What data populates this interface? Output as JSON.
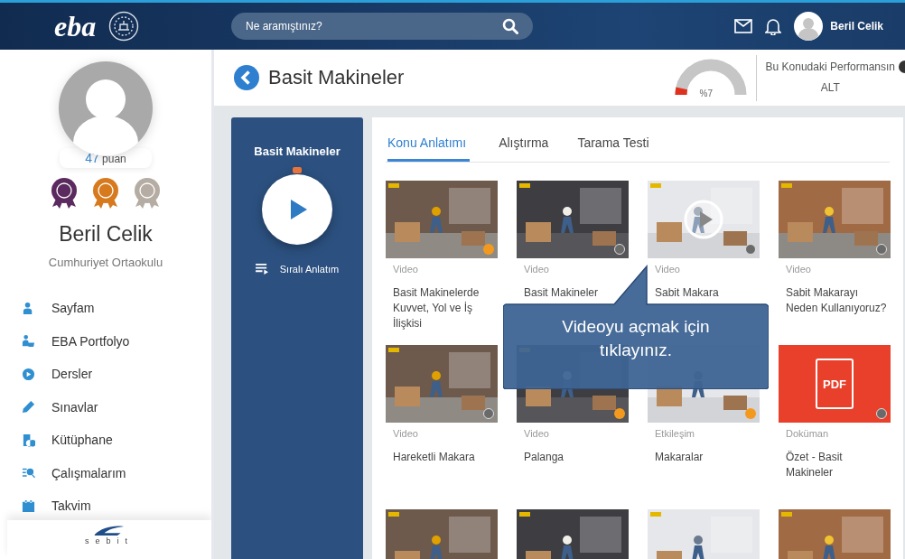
{
  "topbar": {
    "logo": "eba",
    "search": {
      "placeholder": "Ne aramıştınız?"
    },
    "user_name": "Beril Celik"
  },
  "profile": {
    "points": "47",
    "points_unit": "puan",
    "badges": [
      {
        "color": "#5b2a5e"
      },
      {
        "color": "#d77a1e"
      },
      {
        "color": "#b5aca3"
      }
    ],
    "name": "Beril Celik",
    "school": "Cumhuriyet Ortaokulu"
  },
  "nav": [
    {
      "label": "Sayfam"
    },
    {
      "label": "EBA Portfolyo"
    },
    {
      "label": "Dersler"
    },
    {
      "label": "Sınavlar"
    },
    {
      "label": "Kütüphane"
    },
    {
      "label": "Çalışmalarım"
    },
    {
      "label": "Takvim"
    }
  ],
  "sidebar_footer": {
    "logo": "sebit"
  },
  "header": {
    "title": "Basit Makineler",
    "performance": {
      "level": 0.07,
      "reading": "%7",
      "label": "Bu Konudaki Performansın",
      "grade": "ALT"
    }
  },
  "side_panel": {
    "title": "Basit Makineler",
    "playlist_label": "Sıralı Anlatım"
  },
  "tabs": [
    {
      "label": "Konu Anlatımı",
      "selected": true
    },
    {
      "label": "Alıştırma",
      "selected": false
    },
    {
      "label": "Tarama Testi",
      "selected": false
    }
  ],
  "cards": [
    {
      "kind": "picture",
      "type": "Video",
      "title": "Basit Makinelerde Kuvvet, Yol ve İş İlişkisi",
      "started": true,
      "hover": false
    },
    {
      "kind": "picture",
      "type": "Video",
      "title": "Basit Makineler",
      "started": false,
      "hover": false
    },
    {
      "kind": "picture",
      "type": "Video",
      "title": "Sabit Makara",
      "started": false,
      "hover": true
    },
    {
      "kind": "picture",
      "type": "Video",
      "title": "Sabit Makarayı Neden Kullanıyoruz?",
      "started": false,
      "hover": false
    },
    {
      "kind": "picture",
      "type": "Video",
      "title": "Hareketli Makara",
      "started": false,
      "hover": false
    },
    {
      "kind": "picture",
      "type": "Video",
      "title": "Palanga",
      "started": true,
      "hover": false
    },
    {
      "kind": "picture",
      "type": "Etkileşim",
      "title": "Makaralar",
      "started": true,
      "hover": false
    },
    {
      "kind": "pdf",
      "badge": "PDF",
      "type": "Doküman",
      "title": "Özet - Basit Makineler",
      "started": false,
      "hover": false
    },
    {
      "kind": "picture"
    },
    {
      "kind": "picture"
    },
    {
      "kind": "picture"
    },
    {
      "kind": "picture"
    }
  ],
  "tooltip": "Videoyu açmak için tıklayınız."
}
